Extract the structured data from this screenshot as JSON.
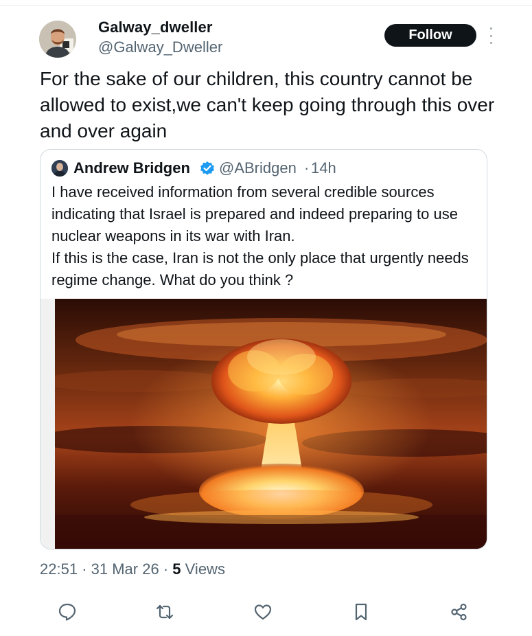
{
  "tweet": {
    "author": {
      "display_name": "Galway_dweller",
      "handle": "@Galway_Dweller"
    },
    "follow_label": "Follow",
    "text": "For the sake of our children, this country cannot be allowed to exist,we can't keep going through this over and over again",
    "timestamp": "22:51",
    "date": "31 Mar 26",
    "separator": "·",
    "views_count": "5",
    "views_label": "Views"
  },
  "quote": {
    "display_name": "Andrew Bridgen",
    "handle": "@ABridgen",
    "separator": "·",
    "time": "14h",
    "verified": true,
    "paragraphs": [
      "I have received information from several credible sources indicating that Israel is prepared and indeed preparing to use nuclear weapons in its war with Iran.",
      "If this is the case, Iran is not the only place that urgently needs regime change. What do you think ?"
    ]
  },
  "actions": [
    {
      "name": "reply-icon"
    },
    {
      "name": "retweet-icon"
    },
    {
      "name": "like-icon"
    },
    {
      "name": "bookmark-icon"
    },
    {
      "name": "share-icon"
    }
  ],
  "colors": {
    "text": "#0f1419",
    "secondary": "#536471",
    "border": "#cfd9de",
    "verified": "#1d9bf0",
    "follow_bg": "#0f1419"
  }
}
